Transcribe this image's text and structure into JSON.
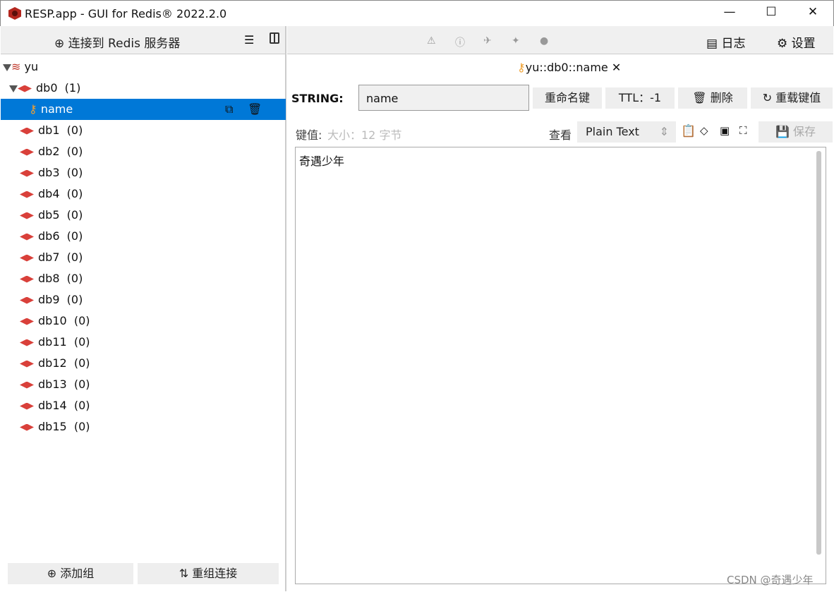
{
  "window": {
    "title": "RESP.app - GUI for Redis® 2022.2.0",
    "minimize": "—",
    "maximize": "☐",
    "close": "✕"
  },
  "left": {
    "connect_label": "连接到 Redis 服务器",
    "server": "yu",
    "dbs": [
      {
        "name": "db0",
        "count": "(1)",
        "expanded": true
      },
      {
        "name": "db1",
        "count": "(0)"
      },
      {
        "name": "db2",
        "count": "(0)"
      },
      {
        "name": "db3",
        "count": "(0)"
      },
      {
        "name": "db4",
        "count": "(0)"
      },
      {
        "name": "db5",
        "count": "(0)"
      },
      {
        "name": "db6",
        "count": "(0)"
      },
      {
        "name": "db7",
        "count": "(0)"
      },
      {
        "name": "db8",
        "count": "(0)"
      },
      {
        "name": "db9",
        "count": "(0)"
      },
      {
        "name": "db10",
        "count": "(0)"
      },
      {
        "name": "db11",
        "count": "(0)"
      },
      {
        "name": "db12",
        "count": "(0)"
      },
      {
        "name": "db13",
        "count": "(0)"
      },
      {
        "name": "db14",
        "count": "(0)"
      },
      {
        "name": "db15",
        "count": "(0)"
      }
    ],
    "selected_key": "name",
    "add_group": "添加组",
    "regroup": "重组连接"
  },
  "toolbar": {
    "log": "日志",
    "settings": "设置"
  },
  "tab": {
    "label": "yu::db0::name"
  },
  "key": {
    "type_label": "STRING:",
    "name_value": "name",
    "rename": "重命名键",
    "ttl": "TTL：-1",
    "delete": "删除",
    "reload": "重载键值",
    "value_label": "键值:",
    "size": "大小：12 字节",
    "view_label": "查看",
    "view_mode": "Plain Text",
    "save": "保存",
    "value": "奇遇少年"
  },
  "watermark": "CSDN @奇遇少年",
  "colors": {
    "selection": "#0078d7",
    "db_icon": "#d9403a",
    "key_icon": "#f0a030"
  }
}
